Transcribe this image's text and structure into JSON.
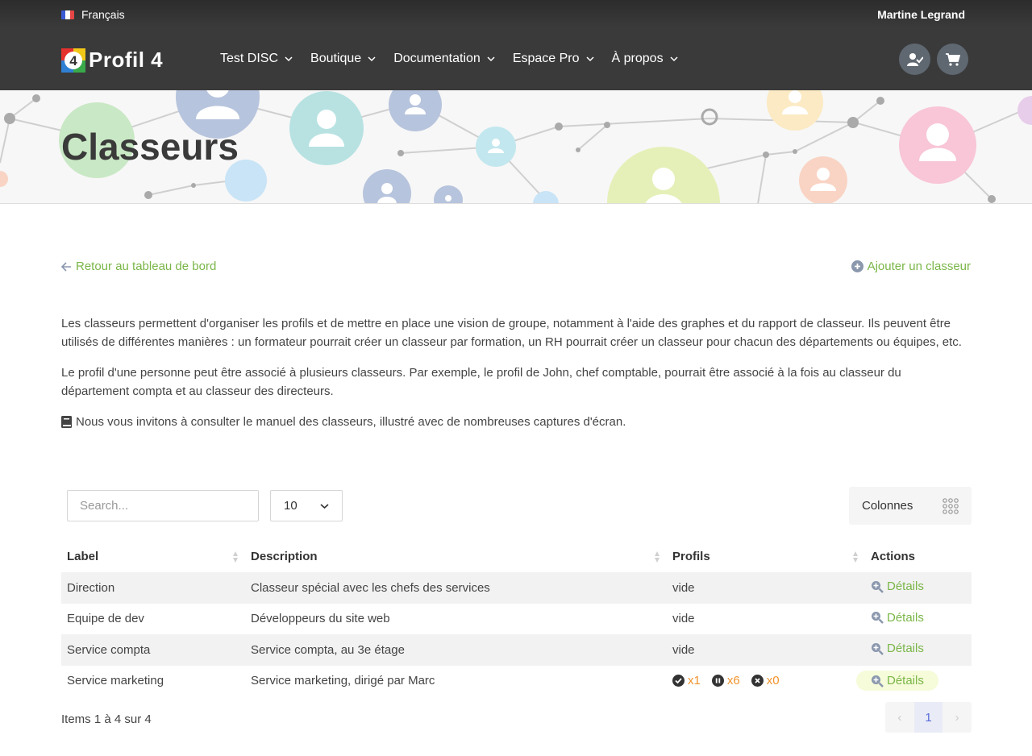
{
  "topbar": {
    "language": "Français",
    "user_name": "Martine Legrand"
  },
  "navbar": {
    "logo_text": "Profil 4",
    "menu": [
      {
        "label": "Test DISC"
      },
      {
        "label": "Boutique"
      },
      {
        "label": "Documentation"
      },
      {
        "label": "Espace Pro"
      },
      {
        "label": "À propos"
      }
    ],
    "icons": [
      "user-check-icon",
      "cart-icon"
    ]
  },
  "banner": {
    "title": "Classeurs"
  },
  "links": {
    "back": "Retour au tableau de bord",
    "add": "Ajouter un classeur"
  },
  "intro": {
    "p1": "Les classeurs permettent d'organiser les profils et de mettre en place une vision de groupe, notamment à l'aide des graphes et du rapport de classeur. Ils peuvent être utilisés de différentes manières : un formateur pourrait créer un classeur par formation, un RH pourrait créer un classeur pour chacun des départements ou équipes, etc.",
    "p2": "Le profil d'une personne peut être associé à plusieurs classeurs. Par exemple, le profil de John, chef comptable, pourrait être associé à la fois au classeur du département compta et au classeur des directeurs.",
    "p3": "Nous vous invitons à consulter le manuel des classeurs, illustré avec de nombreuses captures d'écran."
  },
  "toolbar": {
    "search_placeholder": "Search...",
    "per_page": "10",
    "columns_label": "Colonnes"
  },
  "table": {
    "headers": {
      "label": "Label",
      "description": "Description",
      "profiles": "Profils",
      "actions": "Actions"
    },
    "rows": [
      {
        "label": "Direction",
        "description": "Classeur spécial avec les chefs des services",
        "profiles": "vide",
        "action": "Détails"
      },
      {
        "label": "Equipe de dev",
        "description": "Développeurs du site web",
        "profiles": "vide",
        "action": "Détails"
      },
      {
        "label": "Service compta",
        "description": "Service compta, au 3e étage",
        "profiles": "vide",
        "action": "Détails"
      },
      {
        "label": "Service marketing",
        "description": "Service marketing, dirigé par Marc",
        "profiles_badges": {
          "done": "x1",
          "paused": "x6",
          "cancelled": "x0"
        },
        "action": "Détails"
      }
    ]
  },
  "footer": {
    "items_info": "Items 1 à 4 sur 4",
    "page": "1",
    "prev": "‹",
    "next": "›"
  },
  "colors": {
    "accent_green": "#7ab648",
    "orange": "#f0932b",
    "dark_bar": "#3a3a3a"
  }
}
